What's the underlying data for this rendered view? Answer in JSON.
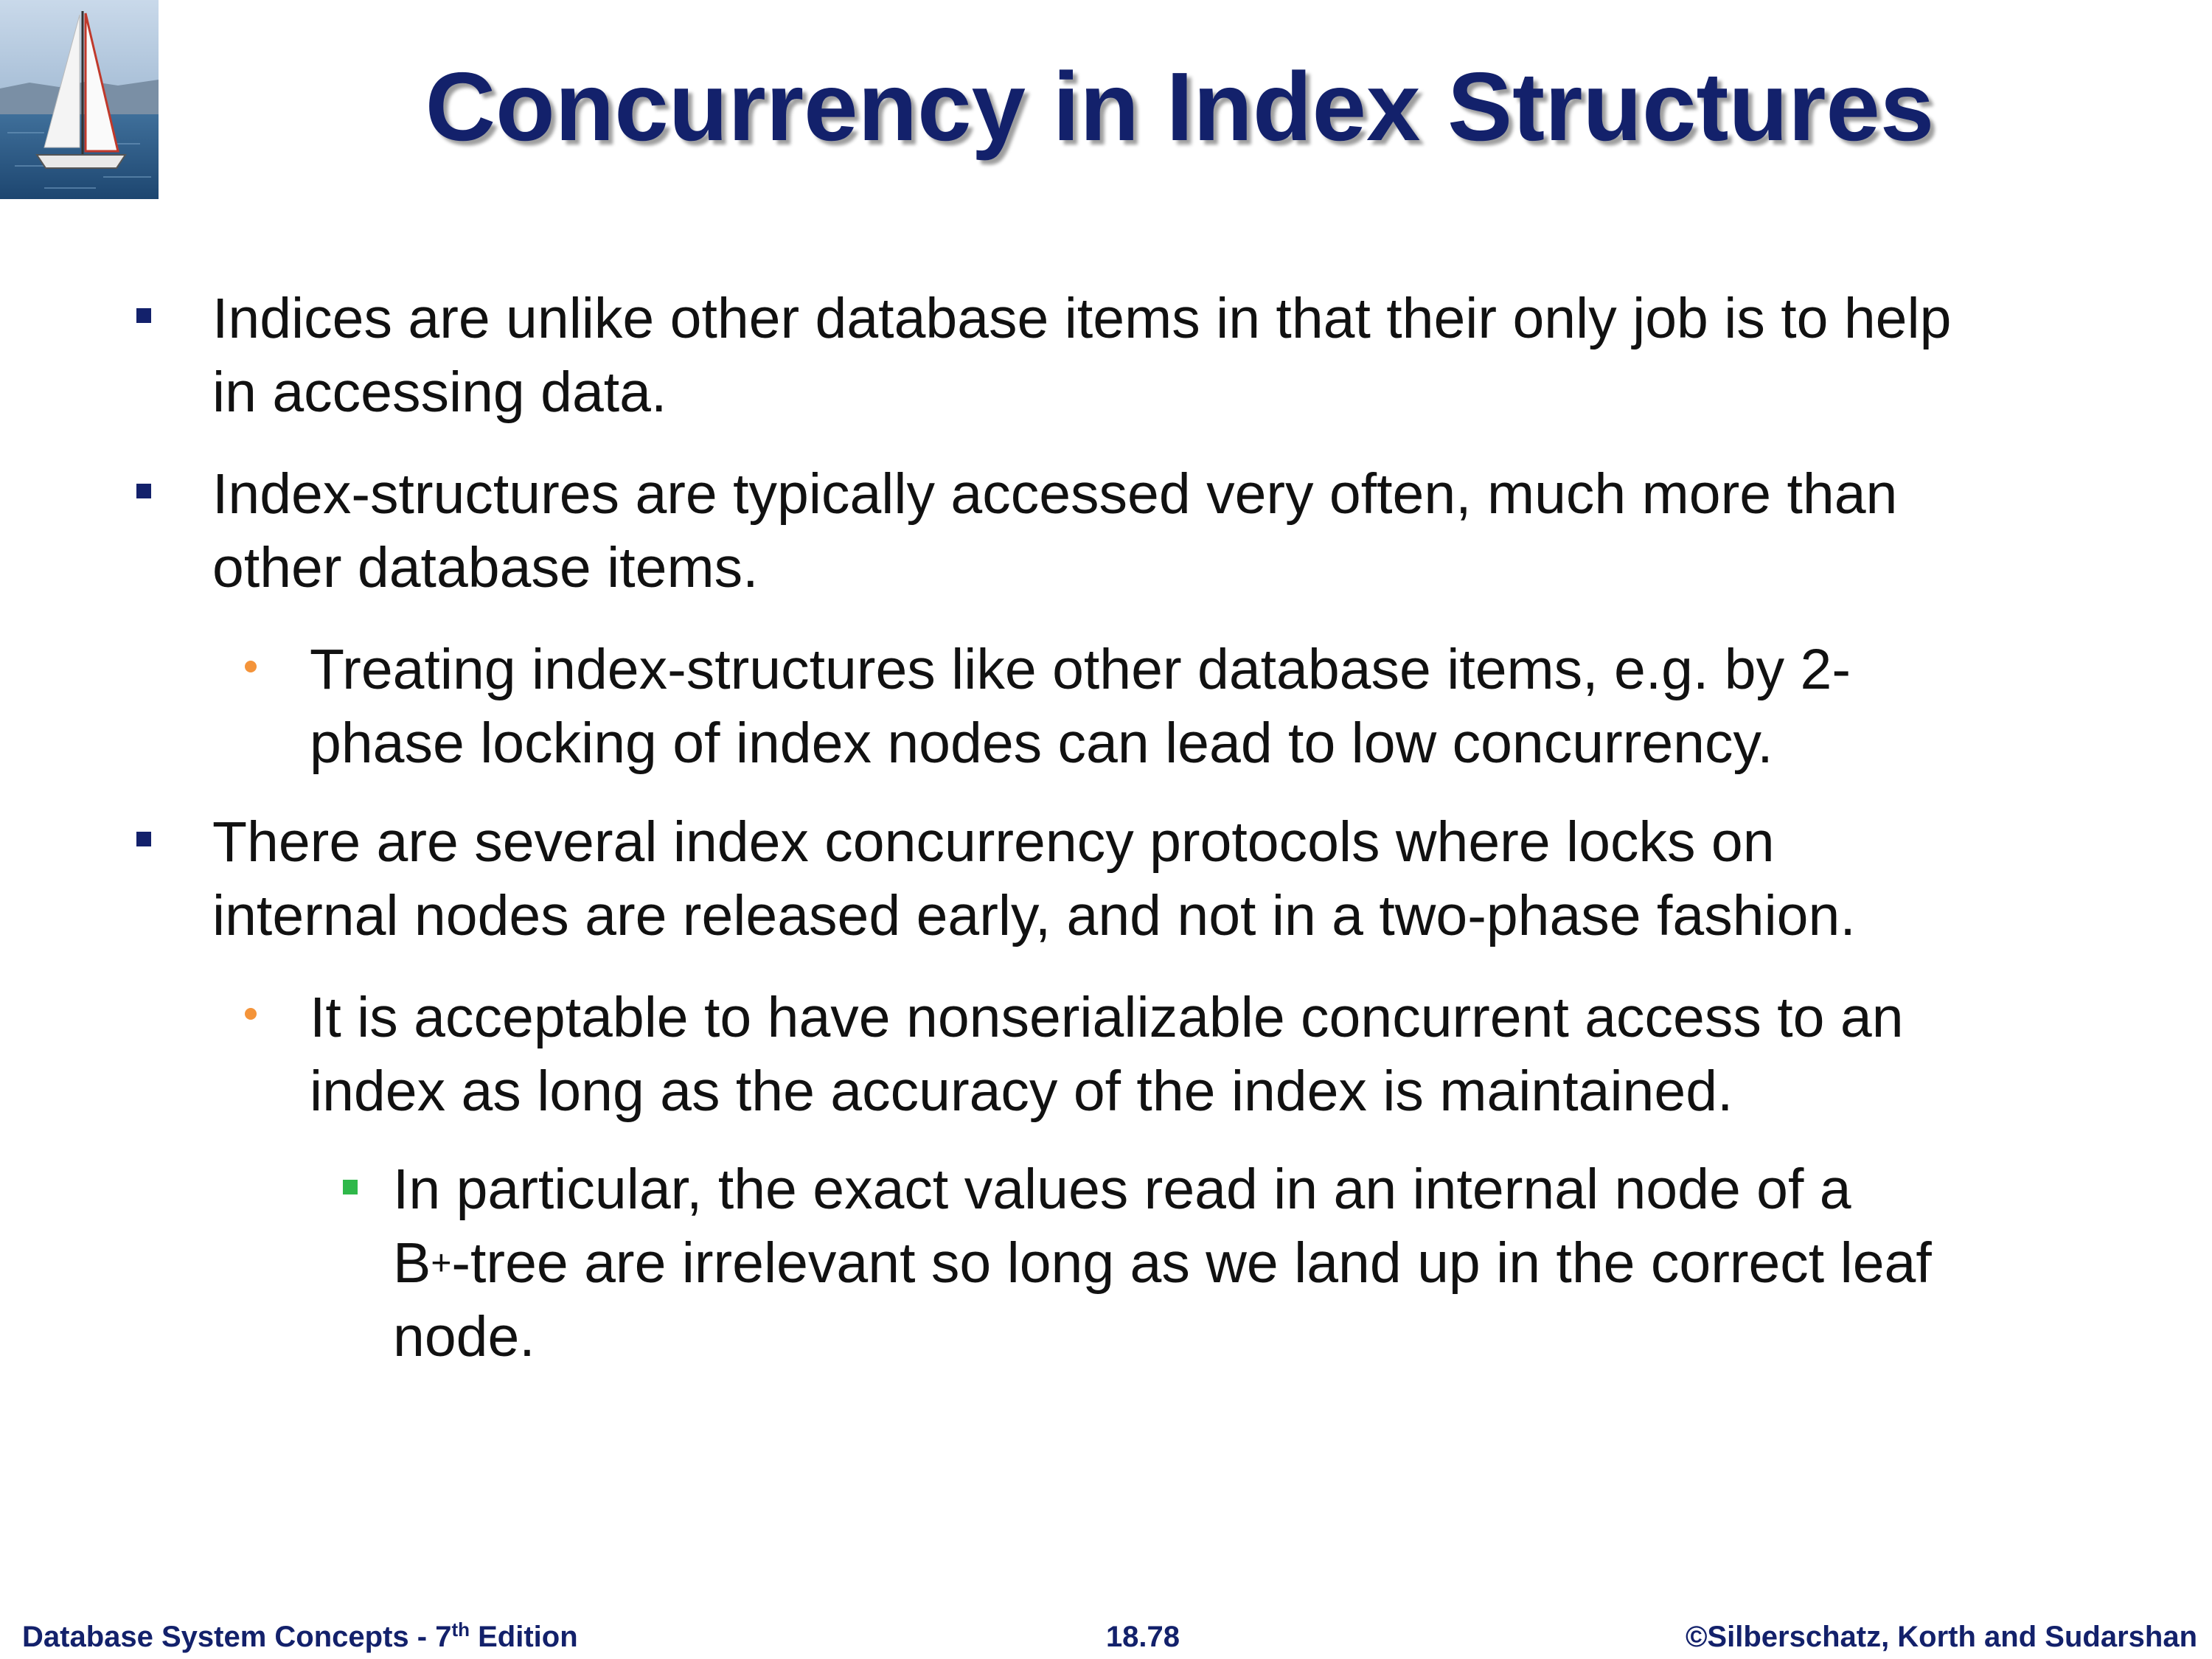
{
  "slide": {
    "title": "Concurrency in Index Structures"
  },
  "bullets": [
    {
      "level": 1,
      "lines": [
        "Indices are unlike other database items in that their only job is to help",
        "in accessing data."
      ]
    },
    {
      "level": 1,
      "lines": [
        "Index-structures are typically accessed very often, much more than",
        "other database items."
      ]
    },
    {
      "level": 2,
      "lines": [
        "Treating index-structures like other database items, e.g. by 2-",
        "phase locking of index nodes can lead to low concurrency."
      ]
    },
    {
      "level": 1,
      "lines": [
        "There are several index concurrency protocols where locks on",
        "internal nodes are released early, and not in a two-phase fashion."
      ]
    },
    {
      "level": 2,
      "lines": [
        "It is acceptable to have nonserializable concurrent access to an",
        "index as long as the accuracy of the index is maintained."
      ]
    },
    {
      "level": 3,
      "line1": "In particular, the exact values read in an internal node of a",
      "line2_pre": "B",
      "line2_sup": "+",
      "line2_post": "-tree are irrelevant so long as we land up in the correct leaf",
      "line3": "node."
    }
  ],
  "footer": {
    "left_pre": "Database System Concepts - 7",
    "left_sup": "th",
    "left_post": " Edition",
    "center": "18.78",
    "right": "©Silberschatz, Korth and Sudarshan"
  },
  "colors": {
    "title": "#13216b",
    "level1_bullet": "#13216b",
    "level2_bullet": "#f4943a",
    "level3_bullet": "#2fb84a",
    "footer_text": "#13216b"
  },
  "icons": {
    "logo": "sailboat-logo"
  }
}
